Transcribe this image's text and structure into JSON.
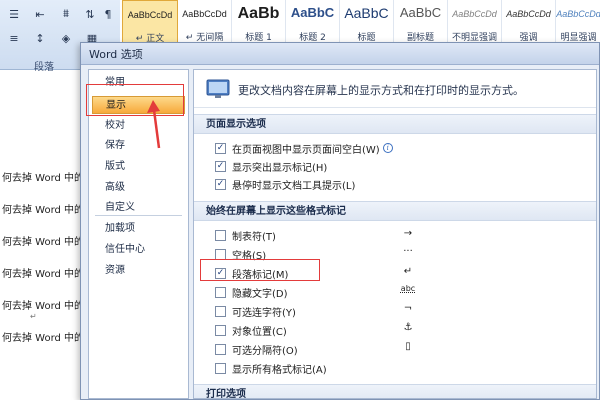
{
  "ribbon": {
    "styles": [
      {
        "sample": "AaBbCcDd",
        "name": "↵ 正文",
        "active": true
      },
      {
        "sample": "AaBbCcDd",
        "name": "↵ 无间隔",
        "active": false
      },
      {
        "sample": "AaBb",
        "name": "标题 1",
        "active": false
      },
      {
        "sample": "AaBbC",
        "name": "标题 2",
        "active": false
      },
      {
        "sample": "AaBbC",
        "name": "标题",
        "active": false
      },
      {
        "sample": "AaBbC",
        "name": "副标题",
        "active": false
      },
      {
        "sample": "AaBbCcDd",
        "name": "不明显强调",
        "active": false
      },
      {
        "sample": "AaBbCcDd",
        "name": "强调",
        "active": false
      },
      {
        "sample": "AaBbCcDd",
        "name": "明显强调",
        "active": false
      }
    ],
    "group_label": "段落"
  },
  "document": {
    "lines": [
      "何去掉 Word 中的",
      "何去掉 Word 中的",
      "何去掉 Word 中的",
      "何去掉 Word 中的",
      "何去掉 Word 中的",
      "何去掉 Word 中的"
    ],
    "paragraph_mark": "↵"
  },
  "dialog": {
    "title": "Word 选项",
    "nav": [
      "常用",
      "显示",
      "校对",
      "保存",
      "版式",
      "高级",
      "自定义",
      "加载项",
      "信任中心",
      "资源"
    ],
    "selected_nav": "显示",
    "header_text": "更改文档内容在屏幕上的显示方式和在打印时的显示方式。",
    "sections": {
      "page_display": "页面显示选项",
      "format_marks": "始终在屏幕上显示这些格式标记",
      "print": "打印选项"
    },
    "page_options": [
      {
        "label": "在页面视图中显示页面间空白(W)",
        "checked": true,
        "info": true
      },
      {
        "label": "显示突出显示标记(H)",
        "checked": true,
        "info": false
      },
      {
        "label": "悬停时显示文档工具提示(L)",
        "checked": true,
        "info": false
      }
    ],
    "mark_options": [
      {
        "label": "制表符(T)",
        "checked": false,
        "glyph": "→"
      },
      {
        "label": "空格(S)",
        "checked": false,
        "glyph": "···"
      },
      {
        "label": "段落标记(M)",
        "checked": true,
        "glyph": "↵"
      },
      {
        "label": "隐藏文字(D)",
        "checked": false,
        "glyph": "abc"
      },
      {
        "label": "可选连字符(Y)",
        "checked": false,
        "glyph": "¬"
      },
      {
        "label": "对象位置(C)",
        "checked": false,
        "glyph": "⚓"
      },
      {
        "label": "可选分隔符(O)",
        "checked": false,
        "glyph": "▯"
      },
      {
        "label": "显示所有格式标记(A)",
        "checked": false,
        "glyph": ""
      }
    ],
    "check_mark": "✓",
    "info_glyph": "i"
  },
  "colors": {
    "annotation_red": "#e33b3b",
    "selected_nav_orange": "#f7a93b"
  }
}
